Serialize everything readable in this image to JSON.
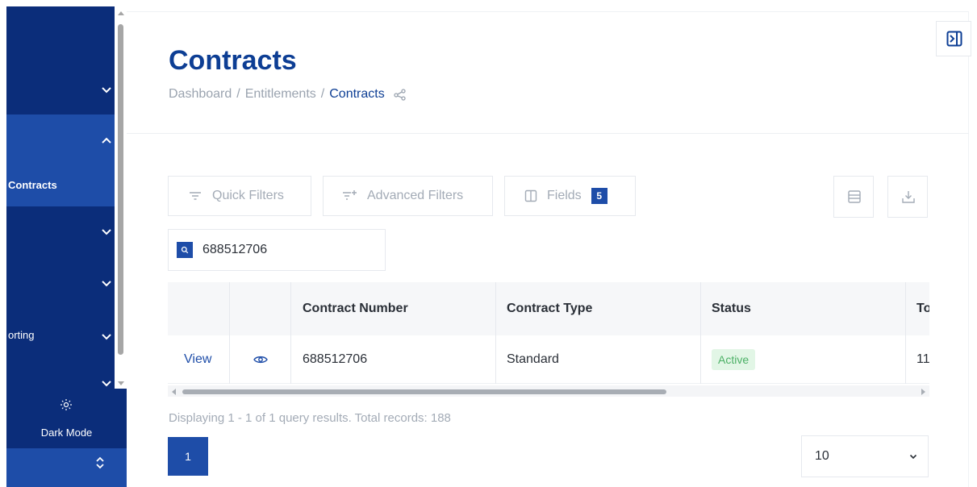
{
  "page": {
    "title": "Contracts",
    "breadcrumb": [
      "Dashboard",
      "/",
      "Entitlements",
      "/",
      "Contracts"
    ]
  },
  "sidebar": {
    "items": [
      {
        "label": "",
        "expanded": false
      },
      {
        "label": "",
        "expanded": true
      },
      {
        "label": "Contracts",
        "active": true
      },
      {
        "label": "",
        "expanded": false
      },
      {
        "label": "",
        "expanded": false
      },
      {
        "label": "orting",
        "expanded": false
      },
      {
        "label": "",
        "expanded": false
      }
    ],
    "dark_mode_label": "Dark Mode"
  },
  "toolbar": {
    "quick_filters": "Quick Filters",
    "advanced_filters": "Advanced Filters",
    "fields": "Fields",
    "fields_count": "5"
  },
  "search": {
    "value": "688512706"
  },
  "table": {
    "columns": [
      "",
      "",
      "Contract Number",
      "Contract Type",
      "Status",
      "To"
    ],
    "rows": [
      {
        "action": "View",
        "contract_number": "688512706",
        "contract_type": "Standard",
        "status": "Active",
        "to": "11"
      }
    ]
  },
  "footer": {
    "results_text": "Displaying 1 - 1 of 1 query results. Total records: 188",
    "current_page": "1",
    "page_size": "10"
  },
  "colors": {
    "sidebar": "#0b2d7a",
    "sidebar_active": "#1e4da8",
    "accent": "#0d3e94",
    "status_active_bg": "#e2f6e6",
    "status_active_fg": "#4bb065"
  }
}
